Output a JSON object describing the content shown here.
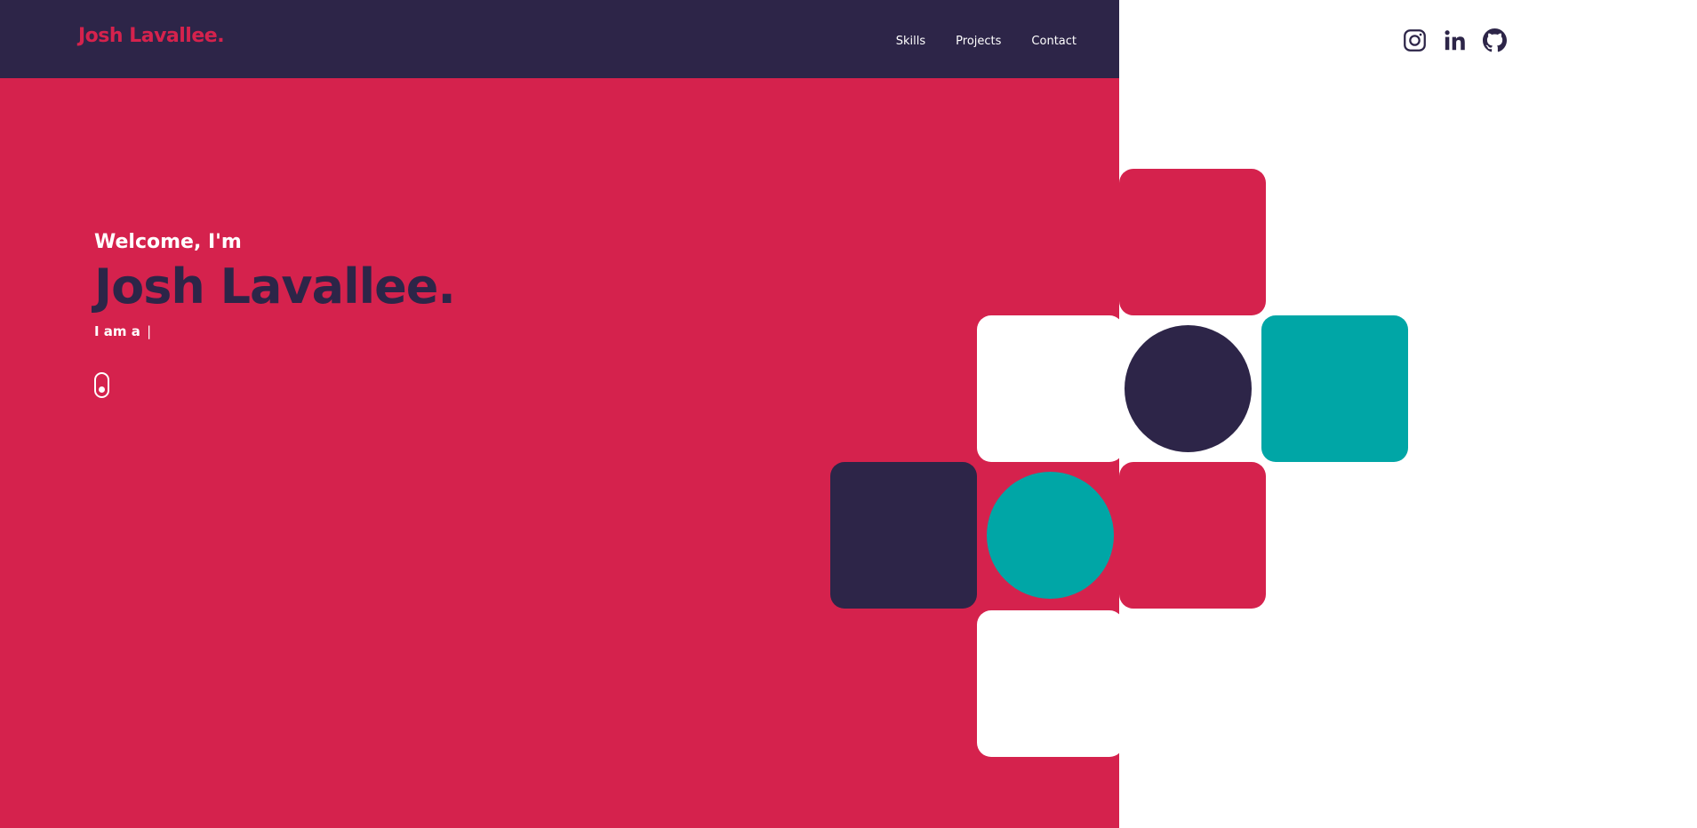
{
  "header": {
    "logo": "Josh Lavallee.",
    "nav": [
      {
        "label": "Skills"
      },
      {
        "label": "Projects"
      },
      {
        "label": "Contact"
      }
    ]
  },
  "social": [
    {
      "icon": "instagram-icon"
    },
    {
      "icon": "linkedin-icon"
    },
    {
      "icon": "github-icon"
    }
  ],
  "hero": {
    "greeting": "Welcome, I'm",
    "name": "Josh Lavallee.",
    "tagline_prefix": "I am a",
    "cursor": "|"
  },
  "colors": {
    "primary": "#d5224d",
    "dark": "#2d2548",
    "teal": "#00a6a6",
    "white": "#ffffff"
  }
}
